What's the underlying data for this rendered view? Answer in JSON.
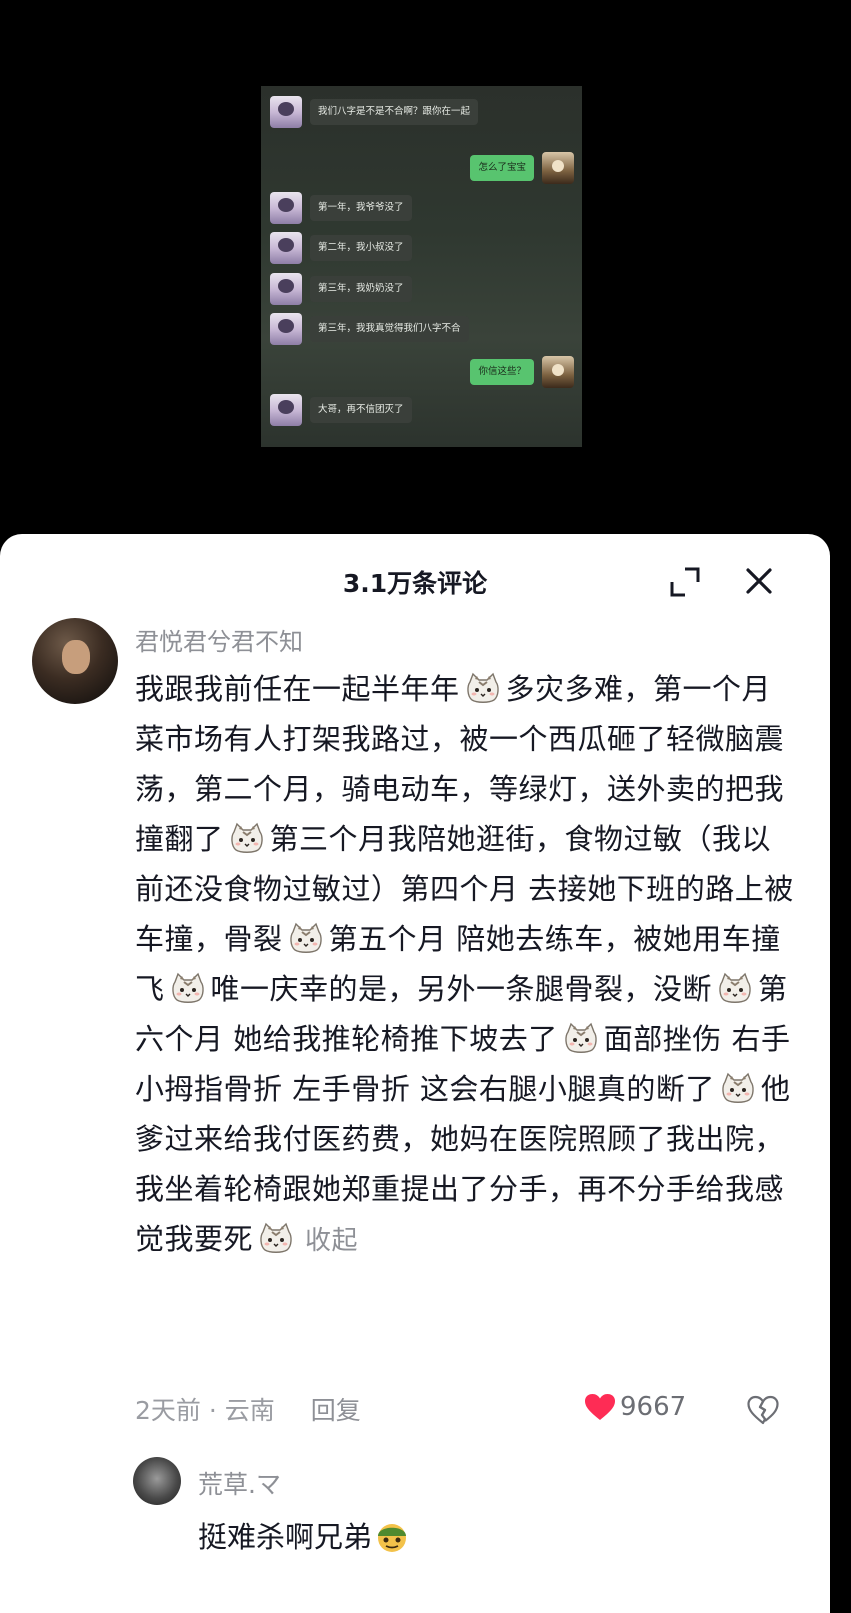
{
  "chat": {
    "messages": [
      {
        "side": "left",
        "text": "我们八字是不是不合啊？跟你在一起"
      },
      {
        "side": "right",
        "text": "怎么了宝宝"
      },
      {
        "side": "left",
        "text": "第一年，我爷爷没了"
      },
      {
        "side": "left",
        "text": "第二年，我小叔没了"
      },
      {
        "side": "left",
        "text": "第三年，我奶奶没了"
      },
      {
        "side": "left",
        "text": "第三年，我我真觉得我们八字不合"
      },
      {
        "side": "right",
        "text": "你信这些？"
      },
      {
        "side": "left",
        "text": "大哥，再不信团灭了"
      }
    ]
  },
  "comments_panel": {
    "title": "3.1万条评论"
  },
  "comment": {
    "username": "君悦君兮君不知",
    "segments": [
      "我跟我前任在一起半年年",
      "多灾多难，第一个月菜市场有人打架我路过，被一个西瓜砸了轻微脑震荡，第二个月，骑电动车，等绿灯，送外卖的把我撞翻了",
      "第三个月我陪她逛街，食物过敏（我以前还没食物过敏过）第四个月 去接她下班的路上被车撞，骨裂",
      "第五个月 陪她去练车，被她用车撞飞",
      "唯一庆幸的是，另外一条腿骨裂，没断",
      "第六个月 她给我推轮椅推下坡去了",
      "面部挫伤 右手小拇指骨折 左手骨折 这会右腿小腿真的断了",
      "他爹过来给我付医药费，她妈在医院照顾了我出院，我坐着轮椅跟她郑重提出了分手，再不分手给我感觉我要死"
    ],
    "collapse_label": "收起",
    "time_location": "2天前 · 云南",
    "reply_label": "回复",
    "likes": "9667"
  },
  "reply": {
    "username": "荒草.マ",
    "text": "挺难杀啊兄弟"
  }
}
